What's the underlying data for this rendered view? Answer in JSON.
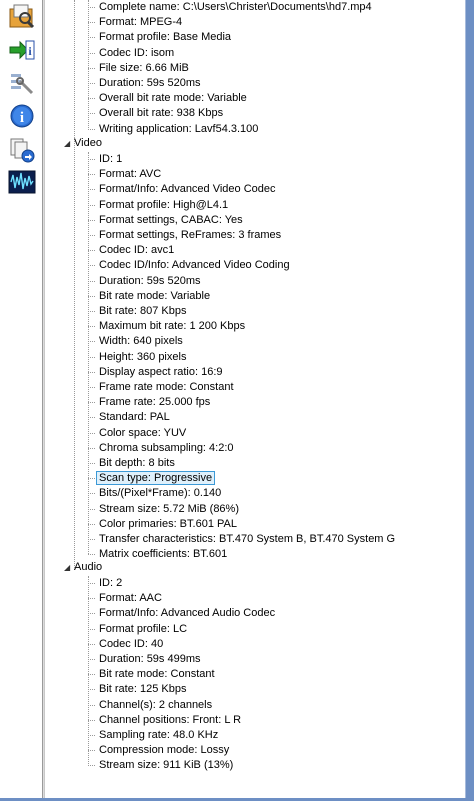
{
  "sidebar": {
    "buttons": [
      {
        "name": "open-file-icon"
      },
      {
        "name": "import-info-icon"
      },
      {
        "name": "preferences-icon"
      },
      {
        "name": "info-icon"
      },
      {
        "name": "export-icon"
      },
      {
        "name": "waveform-icon"
      }
    ]
  },
  "general": {
    "items": [
      "Complete name: C:\\Users\\Christer\\Documents\\hd7.mp4",
      "Format: MPEG-4",
      "Format profile: Base Media",
      "Codec ID: isom",
      "File size: 6.66 MiB",
      "Duration: 59s 520ms",
      "Overall bit rate mode: Variable",
      "Overall bit rate: 938 Kbps",
      "Writing application: Lavf54.3.100"
    ]
  },
  "video": {
    "label": "Video",
    "items": [
      "ID: 1",
      "Format: AVC",
      "Format/Info: Advanced Video Codec",
      "Format profile: High@L4.1",
      "Format settings, CABAC: Yes",
      "Format settings, ReFrames: 3 frames",
      "Codec ID: avc1",
      "Codec ID/Info: Advanced Video Coding",
      "Duration: 59s 520ms",
      "Bit rate mode: Variable",
      "Bit rate: 807 Kbps",
      "Maximum bit rate: 1 200 Kbps",
      "Width: 640 pixels",
      "Height: 360 pixels",
      "Display aspect ratio: 16:9",
      "Frame rate mode: Constant",
      "Frame rate: 25.000 fps",
      "Standard: PAL",
      "Color space: YUV",
      "Chroma subsampling: 4:2:0",
      "Bit depth: 8 bits",
      "Scan type: Progressive",
      "Bits/(Pixel*Frame): 0.140",
      "Stream size: 5.72 MiB (86%)",
      "Color primaries: BT.601 PAL",
      "Transfer characteristics: BT.470 System B, BT.470 System G",
      "Matrix coefficients: BT.601"
    ],
    "selected_index": 21
  },
  "audio": {
    "label": "Audio",
    "items": [
      "ID: 2",
      "Format: AAC",
      "Format/Info: Advanced Audio Codec",
      "Format profile: LC",
      "Codec ID: 40",
      "Duration: 59s 499ms",
      "Bit rate mode: Constant",
      "Bit rate: 125 Kbps",
      "Channel(s): 2 channels",
      "Channel positions: Front: L R",
      "Sampling rate: 48.0 KHz",
      "Compression mode: Lossy",
      "Stream size: 911 KiB (13%)"
    ]
  },
  "colors": {
    "selection_border": "#3c99d6",
    "selection_fill": "#dff0fb",
    "frame": "#6d8fc4"
  }
}
